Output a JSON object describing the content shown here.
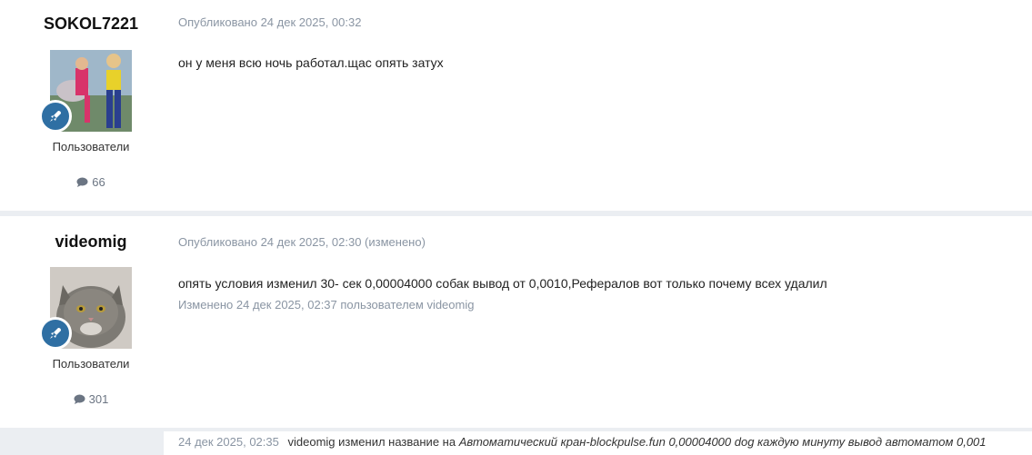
{
  "posts": [
    {
      "username": "SOKOL7221",
      "group": "Пользователи",
      "post_count": "66",
      "meta": "Опубликовано 24 дек 2025, 00:32",
      "content": "он у меня всю ночь работал.щас опять затух",
      "edited": ""
    },
    {
      "username": "videomig",
      "group": "Пользователи",
      "post_count": "301",
      "meta": "Опубликовано 24 дек 2025, 02:30 (изменено)",
      "content": "опять условия изменил 30- сек 0,00004000 собак вывод от 0,0010,Рефералов вот только почему всех удалил",
      "edited": "Изменено 24 дек 2025, 02:37 пользователем videomig"
    }
  ],
  "activity": {
    "time": "24 дек 2025, 02:35",
    "text": "videomig изменил название на",
    "title": "Автоматический кран-blockpulse.fun 0,00004000 dog каждую минуту вывод автоматом 0,001"
  },
  "colors": {
    "badge": "#2f6fa3",
    "meta": "#8a95a3",
    "background": "#ebeef2"
  }
}
